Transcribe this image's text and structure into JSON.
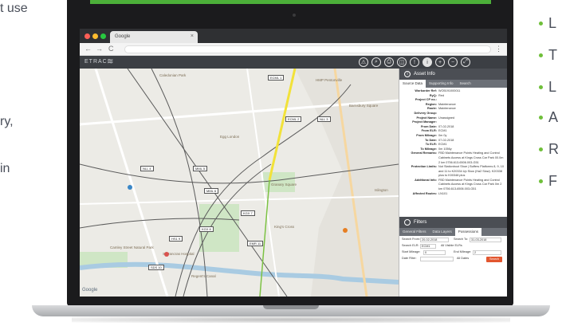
{
  "left_text": [
    "t use",
    "ry,",
    "in"
  ],
  "bullets": [
    "L",
    "T",
    "L",
    "A",
    "R",
    "F"
  ],
  "browser": {
    "tab_title": "Google",
    "tab_close": "×",
    "back": "←",
    "forward": "→",
    "reload": "C",
    "menu": "⋮"
  },
  "app": {
    "brand": "ETRAC",
    "brand_icon": "≋",
    "tools": [
      "⚠",
      "⌕",
      "⎙",
      "◫",
      "!",
      "i",
      "+",
      "−",
      "⤢"
    ]
  },
  "map": {
    "labels": [
      "HMP Pentonville",
      "Caledonian Park",
      "Barnsbury Square",
      "Egg London",
      "King's Cross",
      "St Pancras Hospital",
      "Regent's Canal",
      "Islington",
      "Camley Street Natural Park",
      "Granary Square"
    ],
    "tags": [
      "ECML 1",
      "ECML 2",
      "NLL 3",
      "NLL 4",
      "MML 5",
      "MML 6",
      "KGX 7",
      "KGX 8",
      "HS1 9",
      "SDS 10",
      "EMR 11"
    ],
    "google": "Google"
  },
  "asset_info": {
    "title": "Asset Info",
    "icon": "i",
    "tabs": [
      "Source Data",
      "Supporting Info",
      "Search"
    ],
    "rows": [
      {
        "k": "Workorder Ref:",
        "v": "WO5191000011"
      },
      {
        "k": "RyQ:",
        "v": "Red"
      },
      {
        "k": "Project CP no.:",
        "v": ""
      },
      {
        "k": "Region:",
        "v": "Maintenance"
      },
      {
        "k": "Route:",
        "v": "Maintenance"
      },
      {
        "k": "Delivery Group:",
        "v": ""
      },
      {
        "k": "Project Name:",
        "v": "Unassigned"
      },
      {
        "k": "Project Manager:",
        "v": ""
      },
      {
        "k": "From Date:",
        "v": "07-02-2018"
      },
      {
        "k": "From ELR:",
        "v": "ECM1"
      },
      {
        "k": "From Mileage:",
        "v": "0m 0y"
      },
      {
        "k": "To Date:",
        "v": "07-02-2018"
      },
      {
        "k": "To ELR:",
        "v": "ECM1"
      },
      {
        "k": "To Mileage:",
        "v": "0m 1056y"
      },
      {
        "k": "General Remarks:",
        "v": "FBD Maintenance Points Heating and Control Cabinets Access at Kings Cross Car Park 00.0m 2 km 0756.613-6506.003-G51"
      },
      {
        "k": "Protection Limits:",
        "v": "Not Stationboot Shoe | Buffers Platforms 8, 9, 10 and 11 to K20334 Up Slow (Ha2 Slow). K20338 plus to K00348 plus"
      },
      {
        "k": "Additional Info:",
        "v": "FBD Maintenance Points Heating and Control Cabinets Access at Kings Cross Car Park 0m 2 km 0756.613-6506.003-G51"
      },
      {
        "k": "Affected Routes:",
        "v": "LN101"
      }
    ]
  },
  "filters": {
    "title": "Filters",
    "tabs": [
      "General Filters",
      "Data Layers",
      "Possessions"
    ],
    "search_from_label": "Search From:",
    "search_from_value": "20-02-2018",
    "search_to_label": "Search To:",
    "search_to_value": "31-03-2018",
    "search_elr_label": "Search ELR:",
    "search_elr_value": "ECM1",
    "all_elrs": "All Visible ELRs",
    "start_mileage_label": "Start Mileage:",
    "start_mileage_value": "0",
    "end_mileage_label": "End Mileage:",
    "end_mileage_value": "2",
    "date_filter_label": "Date Filter:",
    "all_dates": "All Dates",
    "search_button": "Search"
  }
}
